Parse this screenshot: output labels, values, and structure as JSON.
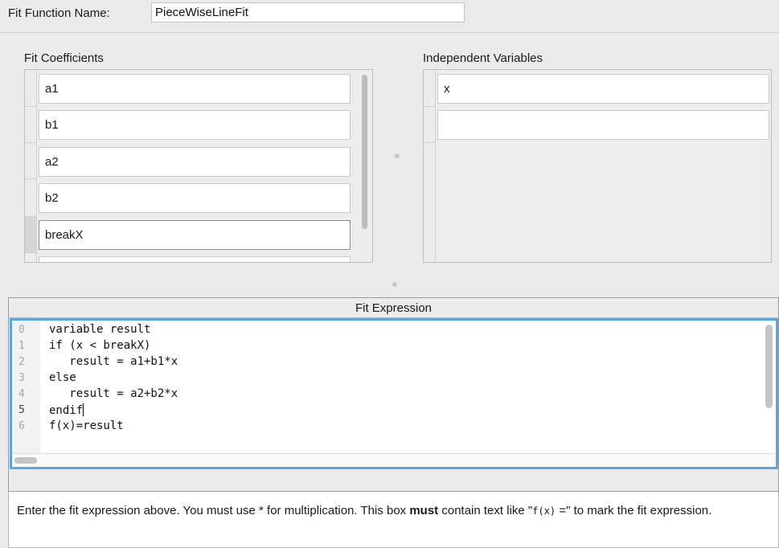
{
  "fit_function": {
    "label": "Fit Function Name:",
    "value": "PieceWiseLineFit"
  },
  "coefficients": {
    "title": "Fit Coefficients",
    "items": [
      "a1",
      "b1",
      "a2",
      "b2",
      "breakX"
    ]
  },
  "independent_variables": {
    "title": "Independent Variables",
    "items": [
      "x",
      ""
    ]
  },
  "fit_expression": {
    "title": "Fit Expression",
    "line_numbers": [
      "0",
      "1",
      "2",
      "3",
      "4",
      "5",
      "6"
    ],
    "lines": [
      "variable result",
      "if (x < breakX)",
      "   result = a1+b1*x",
      "else",
      "   result = a2+b2*x",
      "endif",
      "f(x)=result"
    ],
    "current_line": 5,
    "accent_color": "#5aa5e6"
  },
  "help": {
    "part1": "Enter the fit expression above. You must use ",
    "star": "*",
    "part2": " for multiplication. This box ",
    "bold": "must",
    "part3": " contain text like \"",
    "code": "f(x)",
    "part4": " =\" to mark the fit expression."
  }
}
